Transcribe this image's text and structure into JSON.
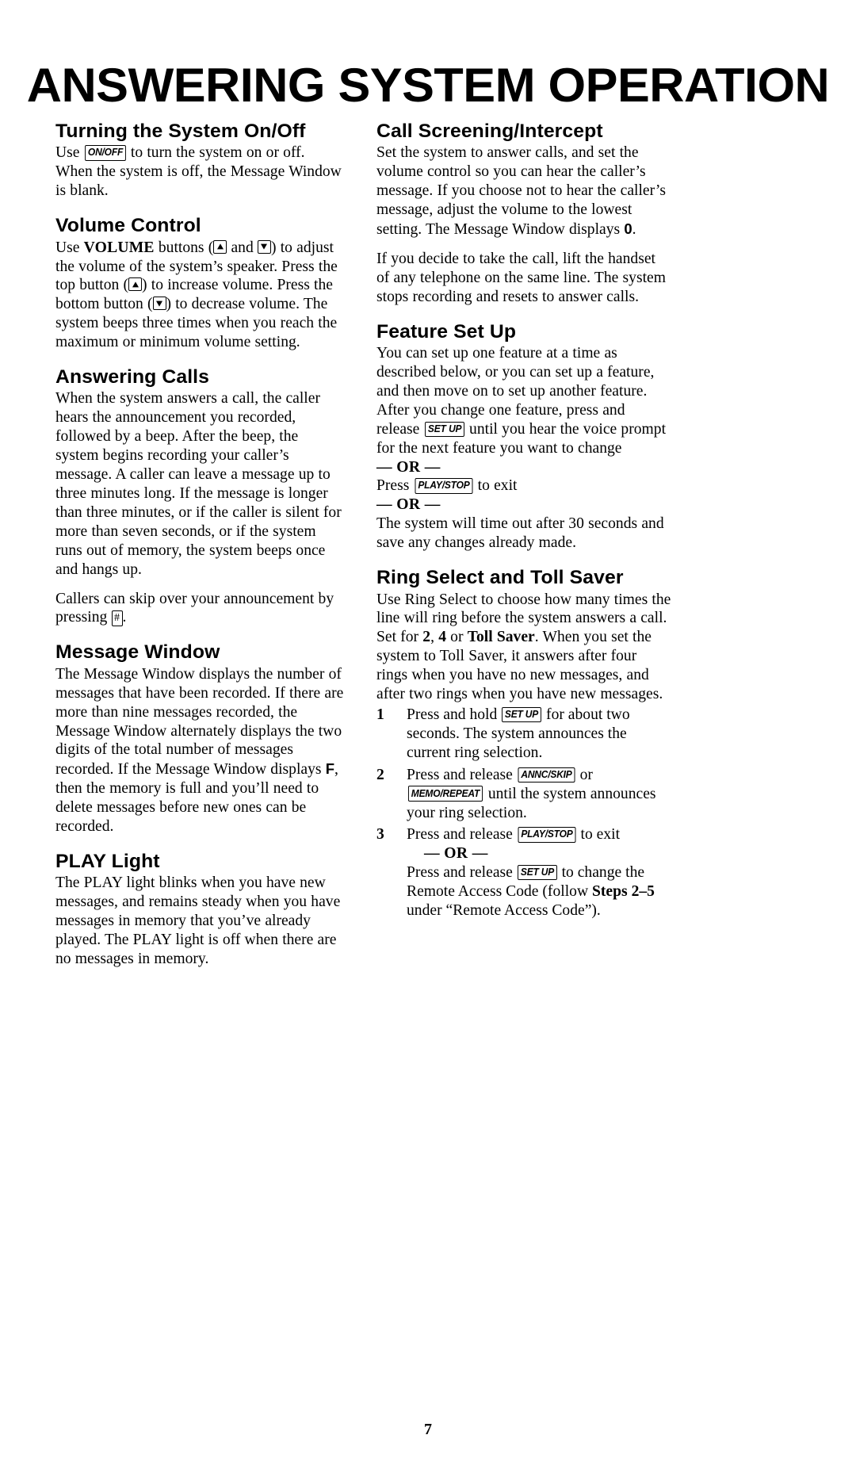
{
  "document": {
    "title": "ANSWERING SYSTEM OPERATION",
    "page_number": "7"
  },
  "keys": {
    "on_off": "ON/OFF",
    "set_up": "SET UP",
    "play_stop": "PLAY/STOP",
    "annc_skip": "ANNC/SKIP",
    "memo_repeat": "MEMO/REPEAT",
    "pound": "#",
    "volume_up": "up-triangle",
    "volume_down": "down-triangle"
  },
  "left_column": {
    "turning_on_off": {
      "heading": "Turning the System On/Off",
      "p1_a": "Use ",
      "p1_b": " to turn the system on or off. When the system is off, the Message Window is blank."
    },
    "volume_control": {
      "heading": "Volume Control",
      "a": "Use ",
      "volume_label": "VOLUME",
      "b": " buttons (",
      "c": " and ",
      "d": ") to adjust the volume of the system’s speaker.  Press the top button (",
      "e": ") to increase volume.  Press the bottom button (",
      "f": ") to decrease volume.  The system beeps three times when you reach the maximum or minimum volume setting."
    },
    "answering_calls": {
      "heading": "Answering Calls",
      "p1": "When the system answers a call, the caller hears the announcement you recorded, followed by a beep.  After the beep, the system begins recording your caller’s message.  A caller can leave a message up to three minutes long.  If the message is longer than three minutes, or if the caller is silent for more than seven seconds, or if the system runs out of memory, the system beeps once and hangs up.",
      "p2_a": "Callers can skip over your announcement by pressing ",
      "p2_b": "."
    },
    "message_window": {
      "heading": "Message Window",
      "a": "The Message Window displays the number of messages that have been recorded.  If there are more than nine messages recorded, the Message Window alternately displays the two digits of the total number of messages recorded.  If the Message Window displays ",
      "display_char": "F",
      "b": ", then the memory is full and you’ll need to delete messages before new ones can be recorded."
    },
    "play_light": {
      "heading": "PLAY Light",
      "p1": "The PLAY light blinks when you have new messages, and remains steady when you have messages in memory that you’ve already played.  The PLAY light is off when there are no messages in memory."
    }
  },
  "right_column": {
    "call_screening": {
      "heading": "Call Screening/Intercept",
      "p1_a": "Set the system to answer calls, and set the volume control so you can hear the caller’s message.  If you choose not to hear the caller’s message, adjust the volume to the lowest setting. The Message Window displays ",
      "display_char": "0",
      "p1_b": ".",
      "p2": "If you decide to take the call, lift the handset of any telephone on the same line. The system stops recording and resets to answer calls."
    },
    "feature_set_up": {
      "heading": "Feature Set Up",
      "p1_a": "You can set up one feature at a time as described below, or you can set up a feature, and then move on to set up another feature. After you change one feature, press and release ",
      "p1_b": " until you hear the voice prompt for the next feature you want to change",
      "or_1": "— OR —",
      "p2_a": "Press ",
      "p2_b": " to exit",
      "or_2": "— OR —",
      "p3": "The system will time out after 30 seconds and save any changes already made."
    },
    "ring_select": {
      "heading": "Ring Select and Toll Saver",
      "p1_a": "Use Ring Select to choose how many times the line will ring before the system answers a call.  Set for ",
      "opt_2": "2",
      "p1_sep1": ", ",
      "opt_4": "4",
      "p1_sep2": " or ",
      "opt_toll_saver": "Toll Saver",
      "p1_b": ".  When you set the system to Toll Saver, it answers after four rings when you have no new messages, and after two rings when you have new messages.",
      "steps": [
        {
          "num": "1",
          "text_a": "Press and hold ",
          "key": "SET UP",
          "text_b": " for about two seconds. The system announces the current ring selection."
        },
        {
          "num": "2",
          "text_a": "Press and release ",
          "key": "ANNC/SKIP",
          "text_mid": " or ",
          "key2": "MEMO/REPEAT",
          "text_b": " until the system announces your ring selection."
        },
        {
          "num": "3",
          "text_a": "Press and release ",
          "key": "PLAY/STOP",
          "text_b": " to exit",
          "or": "— OR —",
          "text_c": "Press and release ",
          "key2": "SET UP",
          "text_d": " to change the Remote Access Code (follow ",
          "bold_a": "Steps",
          "text_e": " ",
          "bold_b": "2–5",
          "text_f": " under “Remote Access Code”)."
        }
      ]
    }
  }
}
